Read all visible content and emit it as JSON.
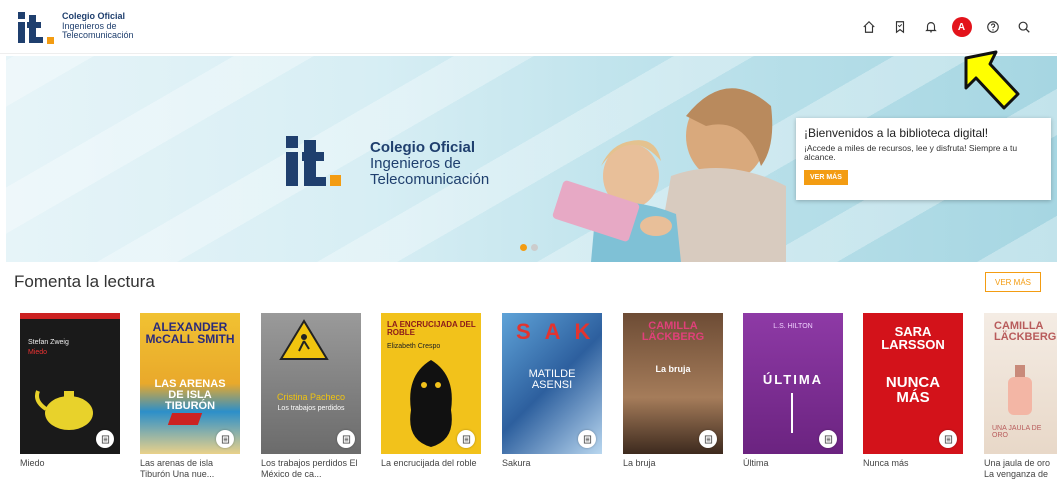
{
  "header": {
    "logo": {
      "line1": "Colegio Oficial",
      "line2": "Ingenieros de",
      "line3": "Telecomunicación"
    },
    "icons": [
      "home-icon",
      "bookmark-icon",
      "bell-icon",
      "avatar",
      "help-icon",
      "search-icon"
    ],
    "avatar_letter": "A",
    "avatar_color": "#e3131b"
  },
  "hero": {
    "logo": {
      "line1": "Colegio Oficial",
      "line2": "Ingenieros de",
      "line3": "Telecomunicación"
    },
    "card_title": "¡Bienvenidos a la biblioteca digital!",
    "card_subtitle": "¡Accede a miles de recursos, lee y disfruta! Siempre a tu alcance.",
    "card_button": "VER MÁS",
    "slides": 2,
    "active_slide": 1
  },
  "section": {
    "title": "Fomenta la lectura",
    "ver_mas": "VER MÁS"
  },
  "books": [
    {
      "caption": "Miedo",
      "cover_title": "Miedo",
      "cover_author": "Stefan Zweig",
      "bg": "#1a1a1a",
      "fg": "#e33"
    },
    {
      "caption": "Las arenas de isla Tiburón Una nue...",
      "cover_title": "LAS ARENAS DE ISLA TIBURÓN",
      "cover_author": "ALEXANDER McCALL SMITH",
      "bg": "#e9a92b",
      "fg": "#fff"
    },
    {
      "caption": "Los trabajos perdidos El México de ca...",
      "cover_title": "Los trabajos perdidos",
      "cover_author": "Cristina Pacheco",
      "bg": "#6b6b6b",
      "fg": "#fff"
    },
    {
      "caption": "La encrucijada del roble",
      "cover_title": "LA ENCRUCIJADA DEL ROBLE",
      "cover_author": "Elizabeth Crespo",
      "bg": "#f2c21b",
      "fg": "#222"
    },
    {
      "caption": "Sakura",
      "cover_title": "SAKURA",
      "cover_author": "MATILDE ASENSI",
      "bg": "#3a7bbf",
      "fg": "#fff"
    },
    {
      "caption": "La bruja",
      "cover_title": "La bruja",
      "cover_author": "CAMILLA LÄCKBERG",
      "bg": "#7d5a3e",
      "fg": "#fff"
    },
    {
      "caption": "Última",
      "cover_title": "ÚLTIMA",
      "cover_author": "L.S. HILTON",
      "bg": "#7b2c8e",
      "fg": "#fff"
    },
    {
      "caption": "Nunca más",
      "cover_title": "NUNCA MÁS",
      "cover_author": "SARA LARSSON",
      "bg": "#d3121a",
      "fg": "#fff"
    },
    {
      "caption": "Una jaula de oro La venganza de u...",
      "cover_title": "UNA JAULA DE ORO",
      "cover_author": "CAMILLA LÄCKBERG",
      "bg": "#f0e6dc",
      "fg": "#b85b5b"
    }
  ]
}
